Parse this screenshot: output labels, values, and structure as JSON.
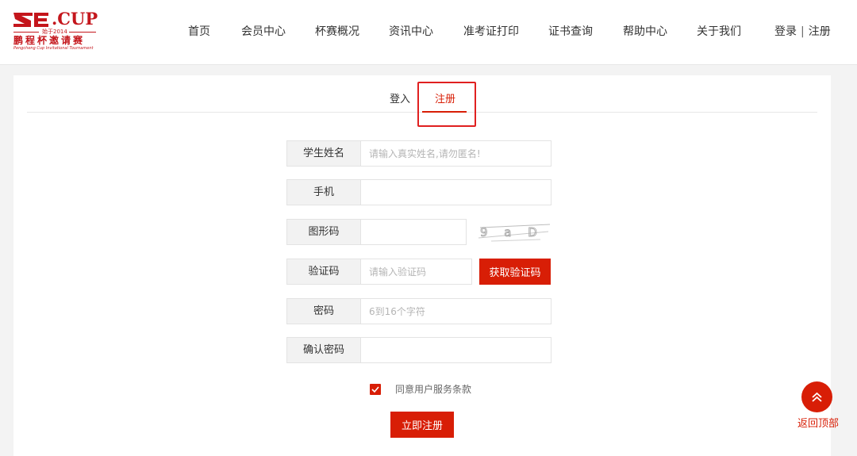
{
  "header": {
    "logo": {
      "brand_text": ".CUP",
      "since_text": "始于2014",
      "cn_name": "鹏程杯邀请赛",
      "en_name": "Pengcheng Cup Invitational Tournament"
    },
    "nav": [
      "首页",
      "会员中心",
      "杯赛概况",
      "资讯中心",
      "准考证打印",
      "证书查询",
      "帮助中心",
      "关于我们"
    ],
    "auth": {
      "login": "登录",
      "separator": "|",
      "register": "注册"
    }
  },
  "tabs": {
    "login": "登入",
    "register": "注册",
    "active": "register"
  },
  "form": {
    "student_name": {
      "label": "学生姓名",
      "placeholder": "请输入真实姓名,请勿匿名!"
    },
    "phone": {
      "label": "手机",
      "placeholder": ""
    },
    "captcha": {
      "label": "图形码",
      "placeholder": "",
      "image_text": "9 a D D"
    },
    "sms_code": {
      "label": "验证码",
      "placeholder": "请输入验证码",
      "button": "获取验证码"
    },
    "password": {
      "label": "密码",
      "placeholder": "6到16个字符"
    },
    "confirm_password": {
      "label": "确认密码",
      "placeholder": ""
    },
    "agree": {
      "label": "同意用户服务条款",
      "checked": true
    },
    "submit": "立即注册"
  },
  "back_to_top": {
    "label": "返回顶部",
    "icon": "double-chevron-up-icon"
  },
  "colors": {
    "accent": "#d81e06",
    "highlight_box": "#e02020"
  }
}
